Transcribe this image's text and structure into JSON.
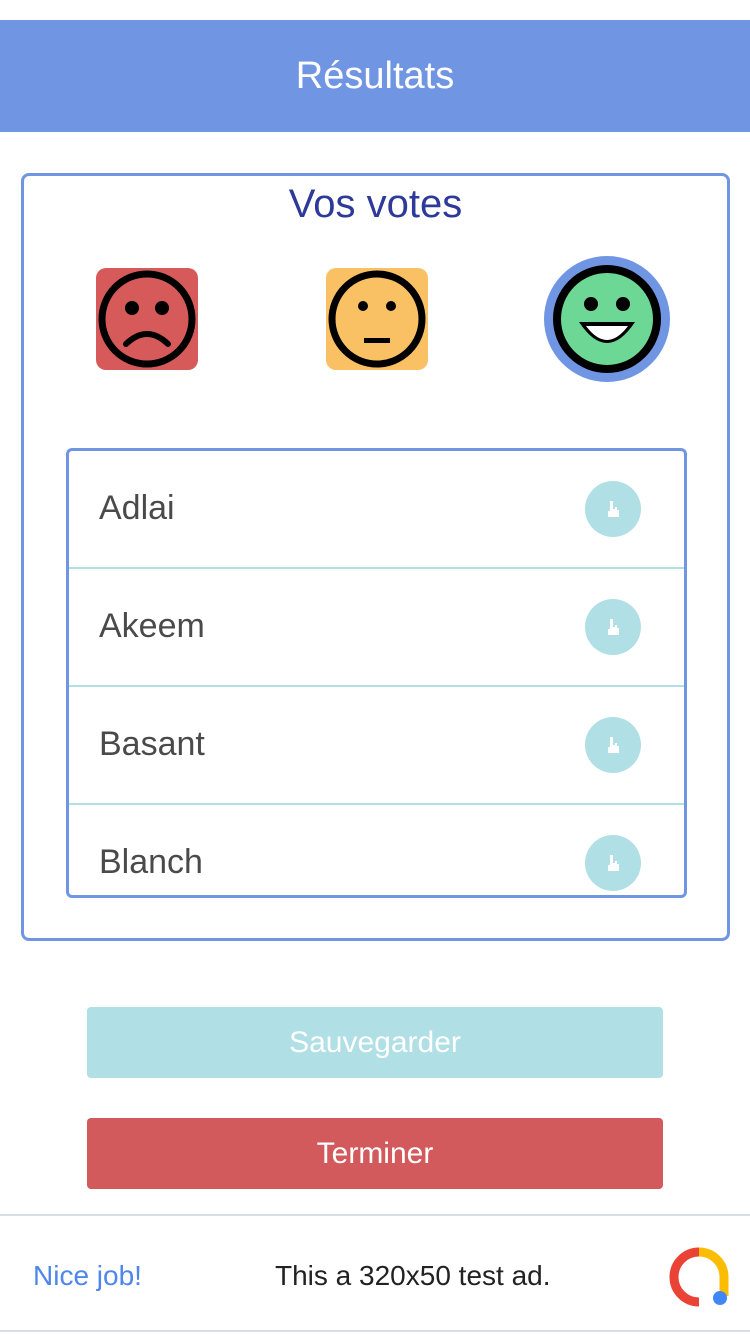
{
  "header": {
    "title": "Résultats"
  },
  "votes": {
    "title": "Vos votes",
    "faces": [
      {
        "icon": "sad-face-icon",
        "color": "#d75a5a"
      },
      {
        "icon": "neutral-face-icon",
        "color": "#f9c064"
      },
      {
        "icon": "happy-face-icon",
        "color": "#6dd796",
        "selected": true
      }
    ]
  },
  "list": {
    "items": [
      {
        "name": "Adlai"
      },
      {
        "name": "Akeem"
      },
      {
        "name": "Basant"
      },
      {
        "name": "Blanch"
      }
    ]
  },
  "buttons": {
    "save_label": "Sauvegarder",
    "end_label": "Terminer"
  },
  "ad": {
    "nice": "Nice job!",
    "text": "This a 320x50 test ad."
  },
  "colors": {
    "accent": "#7096e3",
    "title": "#2e3a99",
    "save": "#b0dfe5",
    "end": "#d35a5c"
  }
}
